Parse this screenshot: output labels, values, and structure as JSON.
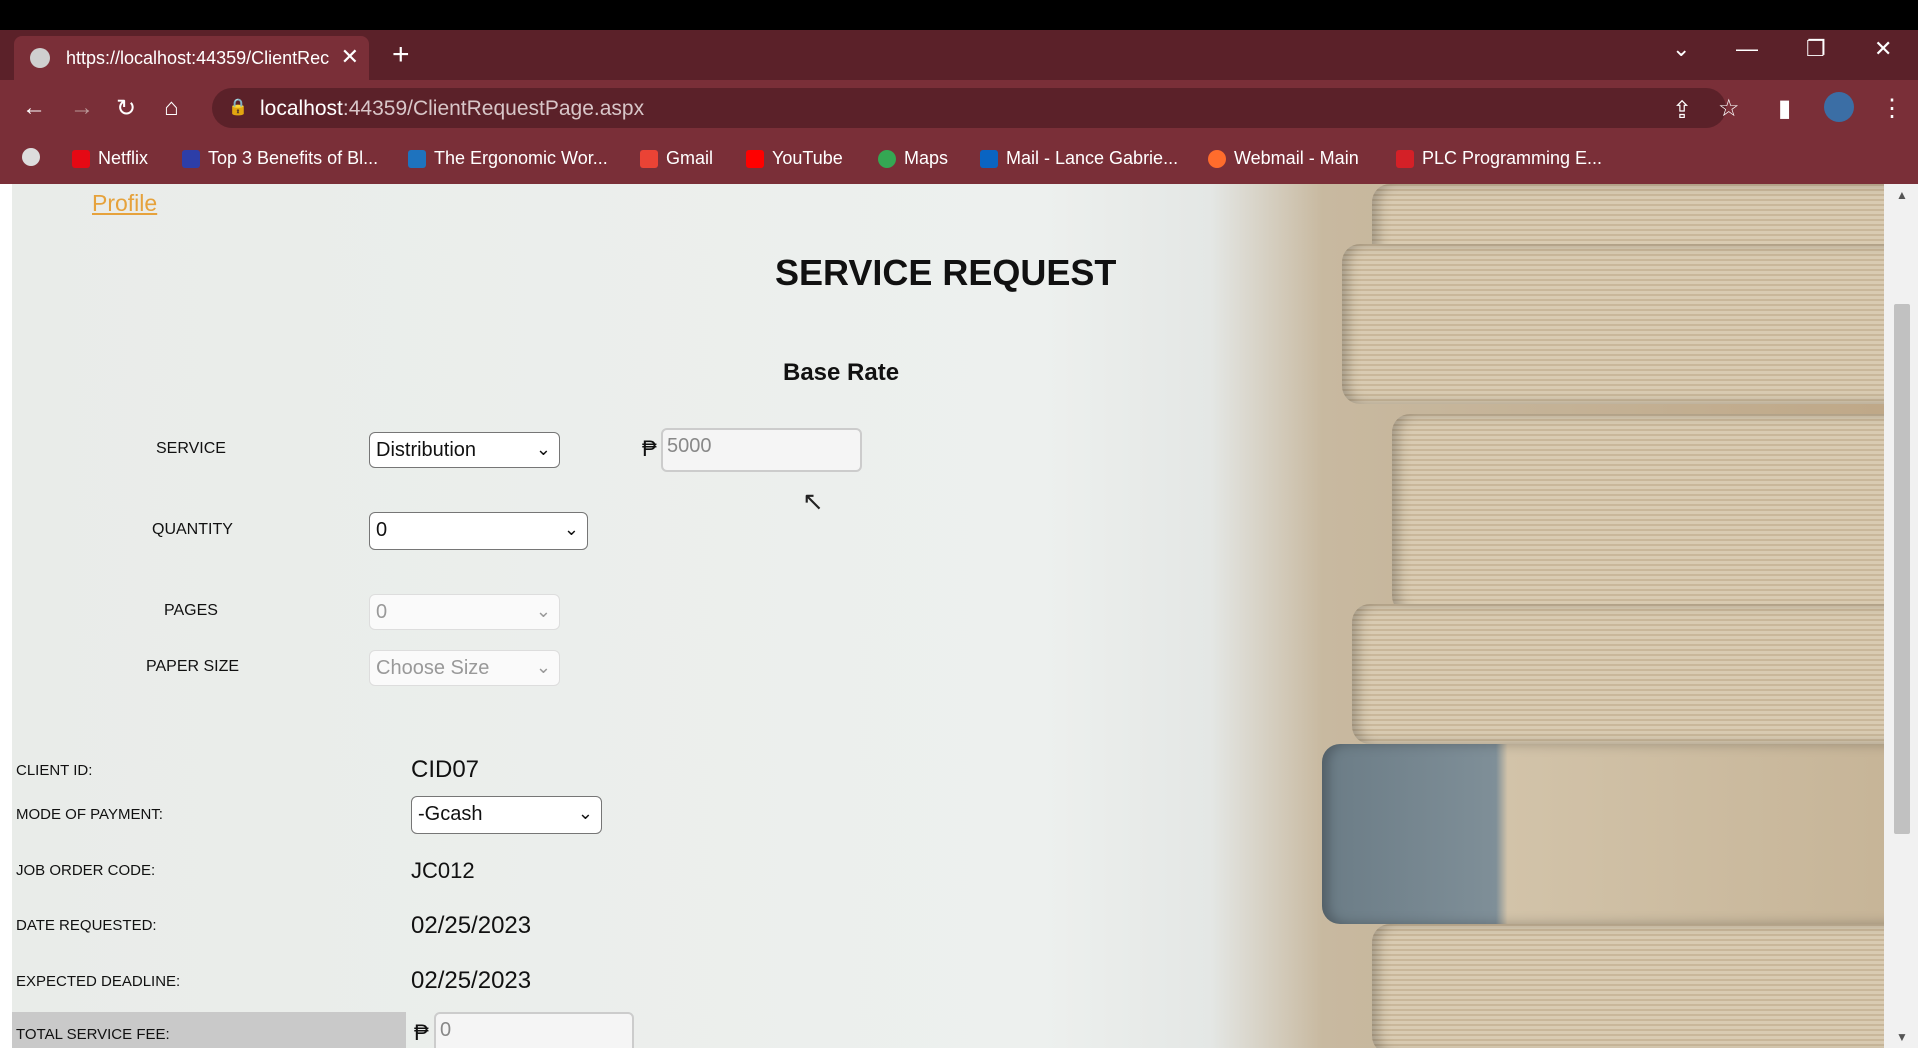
{
  "browser": {
    "tab_title": "https://localhost:44359/ClientRec",
    "url_host": "localhost",
    "url_rest": ":44359/ClientRequestPage.aspx",
    "bookmarks": [
      {
        "label": "Netflix",
        "icon": "netflix-icon",
        "color": "#e50914"
      },
      {
        "label": "Top 3 Benefits of Bl...",
        "icon": "site-icon",
        "color": "#2d3ea8"
      },
      {
        "label": "The Ergonomic Wor...",
        "icon": "pt-icon",
        "color": "#1e73be"
      },
      {
        "label": "Gmail",
        "icon": "gmail-icon",
        "color": "#ea4335"
      },
      {
        "label": "YouTube",
        "icon": "youtube-icon",
        "color": "#ff0000"
      },
      {
        "label": "Maps",
        "icon": "maps-icon",
        "color": "#34a853"
      },
      {
        "label": "Mail - Lance Gabrie...",
        "icon": "outlook-icon",
        "color": "#0a64c2"
      },
      {
        "label": "Webmail - Main",
        "icon": "cpanel-icon",
        "color": "#ff6c2c"
      },
      {
        "label": "PLC Programming E...",
        "icon": "plc-icon",
        "color": "#d42027"
      }
    ]
  },
  "page": {
    "profile_link": "Profile",
    "title": "SERVICE REQUEST",
    "base_rate_heading": "Base Rate",
    "currency_symbol": "₱",
    "service": {
      "label": "SERVICE",
      "value": "Distribution"
    },
    "base_rate_value": "5000",
    "quantity": {
      "label": "QUANTITY",
      "value": "0"
    },
    "pages": {
      "label": "PAGES",
      "value": "0"
    },
    "paper_size": {
      "label": "PAPER SIZE",
      "value": "Choose Size"
    },
    "client_id": {
      "label": "CLIENT ID:",
      "value": "CID07"
    },
    "mode_of_payment": {
      "label": "MODE OF PAYMENT:",
      "value": "-Gcash"
    },
    "job_order_code": {
      "label": "JOB ORDER CODE:",
      "value": "JC012"
    },
    "date_requested": {
      "label": "DATE REQUESTED:",
      "value": "02/25/2023"
    },
    "expected_deadline": {
      "label": "EXPECTED DEADLINE:",
      "value": "02/25/2023"
    },
    "total_service_fee": {
      "label": "TOTAL SERVICE FEE:",
      "value": "0"
    }
  }
}
